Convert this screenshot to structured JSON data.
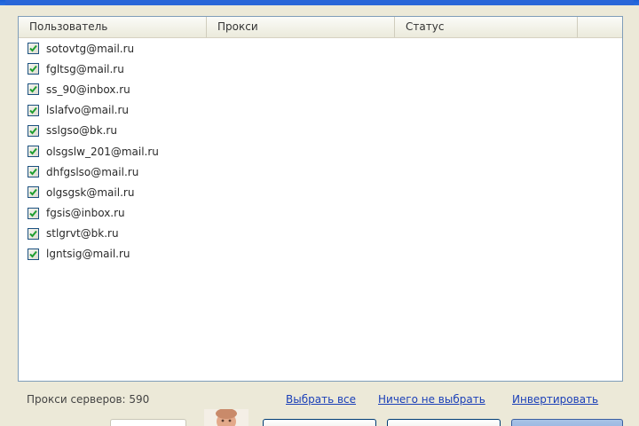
{
  "list": {
    "columns": [
      "Пользователь",
      "Прокси",
      "Статус",
      ""
    ],
    "items": [
      {
        "label": "sotovtg@mail.ru",
        "checked": true
      },
      {
        "label": "fgltsg@mail.ru",
        "checked": true
      },
      {
        "label": "ss_90@inbox.ru",
        "checked": true
      },
      {
        "label": "lslafvo@mail.ru",
        "checked": true
      },
      {
        "label": "sslgso@bk.ru",
        "checked": true
      },
      {
        "label": "olsgslw_201@mail.ru",
        "checked": true
      },
      {
        "label": "dhfgslso@mail.ru",
        "checked": true
      },
      {
        "label": "olgsgsk@mail.ru",
        "checked": true
      },
      {
        "label": "fgsis@inbox.ru",
        "checked": true
      },
      {
        "label": "stlgrvt@bk.ru",
        "checked": true
      },
      {
        "label": "lgntsig@mail.ru",
        "checked": true
      }
    ]
  },
  "footer": {
    "proxy_servers": "Прокси серверов: 590",
    "select_all": "Выбрать все",
    "select_none": "Ничего не выбрать",
    "invert": "Инвертировать"
  },
  "colors": {
    "check": "#1f9e2f",
    "link": "#1a3fb8",
    "title_bar": "#2966d8"
  }
}
